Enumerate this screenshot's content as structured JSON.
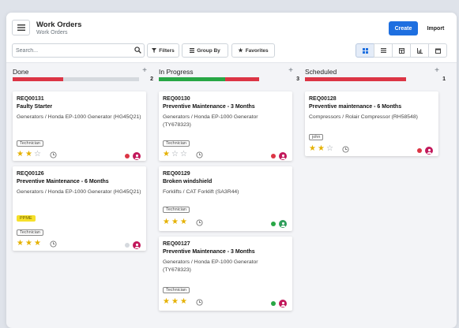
{
  "header": {
    "title": "Work Orders",
    "breadcrumb": "Work Orders",
    "create_label": "Create",
    "import_label": "Import"
  },
  "search": {
    "placeholder": "Search...",
    "value": ""
  },
  "toolbar": {
    "filters_label": "Filters",
    "groupby_label": "Group By",
    "favorites_label": "Favorites"
  },
  "views": [
    "kanban-icon",
    "list-icon",
    "calendar-grid-icon",
    "graph-icon",
    "calendar-icon"
  ],
  "colors": {
    "primary": "#1e6fe0",
    "red": "#dc3545",
    "green": "#28a745",
    "grey": "#d5d9de",
    "star": "#e5b100",
    "avatar": "#c2185b",
    "avatar_green": "#2e9e5b"
  },
  "columns": [
    {
      "title": "Done",
      "count": "2",
      "progress": [
        {
          "fraction": 0.4,
          "color": "red"
        },
        {
          "fraction": 0.6,
          "color": "grey"
        }
      ],
      "cards": [
        {
          "ref": "REQ00131",
          "name": "Faulty Starter",
          "equipment": "Generators / Honda EP-1000 Generator (HG45Q21)",
          "tags": [
            "Technician"
          ],
          "stars": 2,
          "status": "red",
          "avatar": "pink"
        },
        {
          "ref": "REQ00126",
          "name": "Preventive Maintenance - 6 Months",
          "equipment": "Generators / Honda EP-1000 Generator (HG45Q21)",
          "highlight_tag": "PPME",
          "tags": [
            "Technician"
          ],
          "stars": 3,
          "status": "grey",
          "avatar": "pink"
        }
      ]
    },
    {
      "title": "In Progress",
      "count": "3",
      "progress": [
        {
          "fraction": 0.66,
          "color": "green"
        },
        {
          "fraction": 0.34,
          "color": "red"
        }
      ],
      "cards": [
        {
          "ref": "REQ00130",
          "name": "Preventive Maintenance - 3 Months",
          "equipment": "Generators / Honda EP-1000 Generator (TY678323)",
          "tags": [
            "Technician"
          ],
          "stars": 1,
          "status": "red",
          "avatar": "pink"
        },
        {
          "ref": "REQ00129",
          "name": "Broken windshield",
          "equipment": "Forklifts / CAT Forklift (SA3R44)",
          "tags": [
            "Technician"
          ],
          "stars": 3,
          "status": "green",
          "avatar": "green"
        },
        {
          "ref": "REQ00127",
          "name": "Preventive Maintenance - 3 Months",
          "equipment": "Generators / Honda EP-1000 Generator (TY678323)",
          "tags": [
            "Technician"
          ],
          "stars": 3,
          "status": "green",
          "avatar": "pink"
        }
      ]
    },
    {
      "title": "Scheduled",
      "count": "1",
      "progress": [
        {
          "fraction": 0.8,
          "color": "red"
        },
        {
          "fraction": 0.2,
          "color": "grey"
        }
      ],
      "cards": [
        {
          "ref": "REQ00128",
          "name": "Preventive maintenance - 6 Months",
          "equipment": "Compressors / Rolair Compressor (RH58548)",
          "tags": [
            "john"
          ],
          "stars": 2,
          "status": "red",
          "avatar": "pink"
        }
      ]
    }
  ]
}
